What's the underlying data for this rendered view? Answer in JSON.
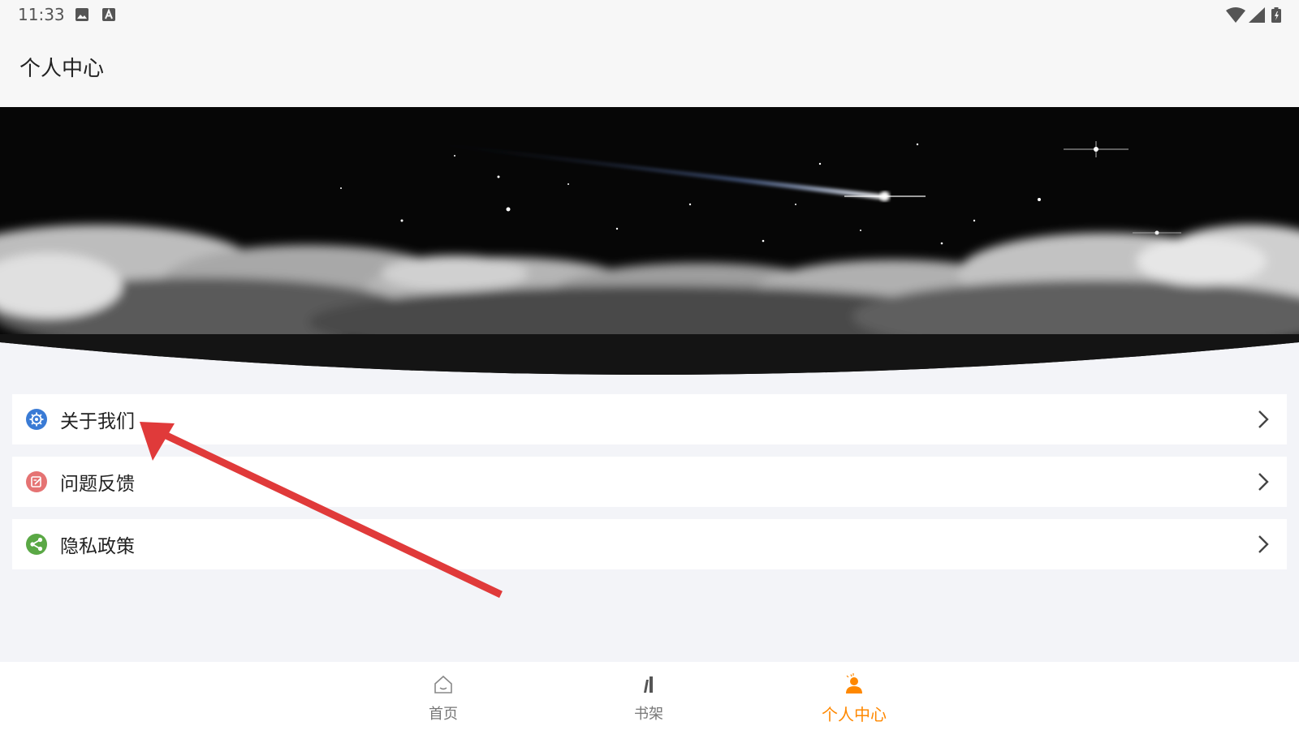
{
  "status_bar": {
    "time": "11:33",
    "left_icons": [
      "image-icon",
      "text-a-icon"
    ],
    "right_icons": [
      "wifi-icon",
      "signal-icon",
      "battery-icon"
    ]
  },
  "header": {
    "title": "个人中心"
  },
  "banner": {
    "image": "night-sky-meteor-clouds"
  },
  "menu": [
    {
      "label": "关于我们",
      "icon": "gear-icon",
      "color": "#3a7bd5"
    },
    {
      "label": "问题反馈",
      "icon": "edit-icon",
      "color": "#e57373"
    },
    {
      "label": "隐私政策",
      "icon": "share-icon",
      "color": "#5aa845"
    }
  ],
  "bottom_nav": {
    "active_color": "#ff8800",
    "tabs": [
      {
        "label": "首页",
        "icon": "home-icon",
        "active": false
      },
      {
        "label": "书架",
        "icon": "bookshelf-icon",
        "active": false
      },
      {
        "label": "个人中心",
        "icon": "person-icon",
        "active": true
      }
    ]
  },
  "annotation": {
    "type": "arrow",
    "color": "#e03a3a",
    "points_to": "关于我们"
  }
}
